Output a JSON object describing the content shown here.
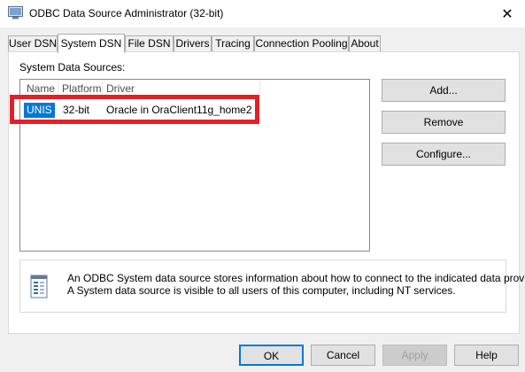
{
  "window": {
    "title": "ODBC Data Source Administrator (32-bit)",
    "close_glyph": "✕"
  },
  "tabs": [
    {
      "label": "User DSN",
      "active": false
    },
    {
      "label": "System DSN",
      "active": true
    },
    {
      "label": "File DSN",
      "active": false
    },
    {
      "label": "Drivers",
      "active": false
    },
    {
      "label": "Tracing",
      "active": false
    },
    {
      "label": "Connection Pooling",
      "active": false
    },
    {
      "label": "About",
      "active": false
    }
  ],
  "system_dsn": {
    "group_label": "System Data Sources:",
    "columns": [
      "Name",
      "Platform",
      "Driver"
    ],
    "rows": [
      {
        "name": "UNIS",
        "platform": "32-bit",
        "driver": "Oracle in OraClient11g_home2",
        "selected": true
      }
    ],
    "highlight_color": "#e41f26",
    "selection_color": "#0078d7"
  },
  "side_buttons": {
    "add": "Add...",
    "remove": "Remove",
    "configure": "Configure..."
  },
  "info": {
    "line1": "An ODBC System data source stores information about how to connect to the indicated data provider.",
    "line2": "A System data source is visible to all users of this computer, including NT services.",
    "icon": "data-source-info-icon"
  },
  "footer_buttons": {
    "ok": "OK",
    "cancel": "Cancel",
    "apply": "Apply",
    "help": "Help"
  }
}
